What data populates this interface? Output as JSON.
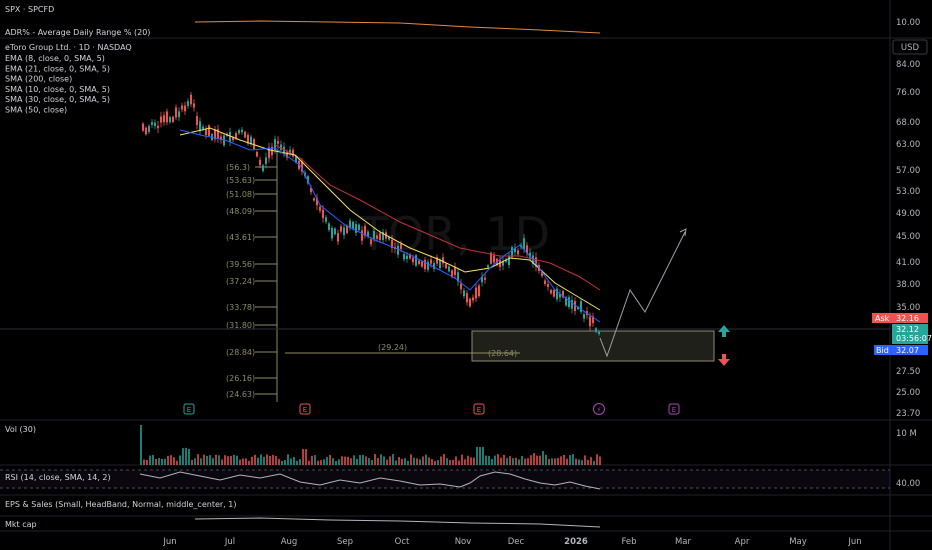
{
  "colors": {
    "up": "#26a69a",
    "down": "#ef5350",
    "ema8": "#2962ff",
    "ema21": "#f7e463",
    "sma50": "#c2303f",
    "sma10": "#4dd0e1",
    "sma30": "#ff9800",
    "fib": "#8d8a63",
    "box": "#c8c8a0",
    "path": "#9aa0a6",
    "pane_line": "#b2b5be"
  },
  "top_pane": {
    "symbol": "SPX · SPCFD",
    "indicator": "ADR% - Average Daily Range % (20)",
    "axis_tick": "10.00"
  },
  "header": {
    "title": "eToro Group Ltd. · 1D · NASDAQ",
    "indicators": [
      "EMA (8, close, 0, SMA, 5)",
      "EMA (21, close, 0, SMA, 5)",
      "SMA (200, close)",
      "SMA (10, close, 0, SMA, 5)",
      "SMA (30, close, 0, SMA, 5)",
      "SMA (50, close)"
    ]
  },
  "currency": "USD",
  "watermark": "TOR, 1D",
  "price_axis": [
    "84.00",
    "76.00",
    "68.00",
    "63.00",
    "57.00",
    "53.00",
    "49.00",
    "45.00",
    "41.00",
    "38.00",
    "35.00",
    "27.50",
    "25.00",
    "23.70"
  ],
  "fib_levels": [
    "(56.3)",
    "(53.63)",
    "(51.08)",
    "(48.09)",
    "(43.61)",
    "(39.56)",
    "(37.24)",
    "(33.78)",
    "(31.80)",
    "(28.84)",
    "(26.16)",
    "(24.63)"
  ],
  "zone_labels": [
    "(29.24)",
    "(28.64)"
  ],
  "ask": {
    "label": "Ask",
    "value": "32.16"
  },
  "last": {
    "value": "32.12",
    "timer": "03:56:07"
  },
  "bid": {
    "label": "Bid",
    "value": "32.07"
  },
  "event_markers": [
    "E",
    "E",
    "E",
    "E"
  ],
  "dividend_marker": "⚡",
  "time_axis": [
    "Jun",
    "Jul",
    "Aug",
    "Sep",
    "Oct",
    "Nov",
    "Dec",
    "2026",
    "Feb",
    "Mar",
    "Apr",
    "May",
    "Jun"
  ],
  "vol_pane": {
    "label": "Vol (30)",
    "axis_tick": "10 M"
  },
  "rsi_pane": {
    "label": "RSI (14, close, SMA, 14, 2)",
    "axis_tick": "40.00"
  },
  "eps_pane": {
    "label": "EPS & Sales (Small, HeadBand, Normal, middle_center, 1)"
  },
  "mcap_pane": {
    "label": "Mkt cap"
  },
  "chart_data": {
    "type": "line",
    "x": [
      "Jun",
      "Jul",
      "Aug",
      "Sep",
      "Oct",
      "Nov",
      "Dec",
      "2026"
    ],
    "series": [
      {
        "values": [
          66,
          68,
          63,
          46,
          41,
          36,
          43,
          32
        ]
      }
    ],
    "projection": [
      32,
      29.5,
      36,
      33,
      45
    ],
    "target_zone": [
      28.64,
      31.8
    ],
    "ylim": [
      23.7,
      84
    ]
  }
}
